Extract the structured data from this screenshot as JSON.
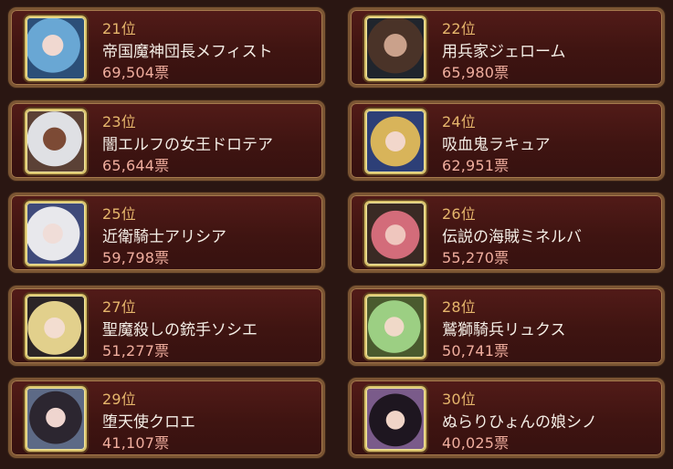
{
  "cards": [
    {
      "rank": "21位",
      "name": "帝国魔神団長メフィスト",
      "votes": "69,504票"
    },
    {
      "rank": "22位",
      "name": "用兵家ジェローム",
      "votes": "65,980票"
    },
    {
      "rank": "23位",
      "name": "闇エルフの女王ドロテア",
      "votes": "65,644票"
    },
    {
      "rank": "24位",
      "name": "吸血鬼ラキュア",
      "votes": "62,951票"
    },
    {
      "rank": "25位",
      "name": "近衛騎士アリシア",
      "votes": "59,798票"
    },
    {
      "rank": "26位",
      "name": "伝説の海賊ミネルバ",
      "votes": "55,270票"
    },
    {
      "rank": "27位",
      "name": "聖魔殺しの銃手ソシエ",
      "votes": "51,277票"
    },
    {
      "rank": "28位",
      "name": "鷲獅騎兵リュクス",
      "votes": "50,741票"
    },
    {
      "rank": "29位",
      "name": "堕天使クロエ",
      "votes": "41,107票"
    },
    {
      "rank": "30位",
      "name": "ぬらりひょんの娘シノ",
      "votes": "40,025票"
    }
  ]
}
